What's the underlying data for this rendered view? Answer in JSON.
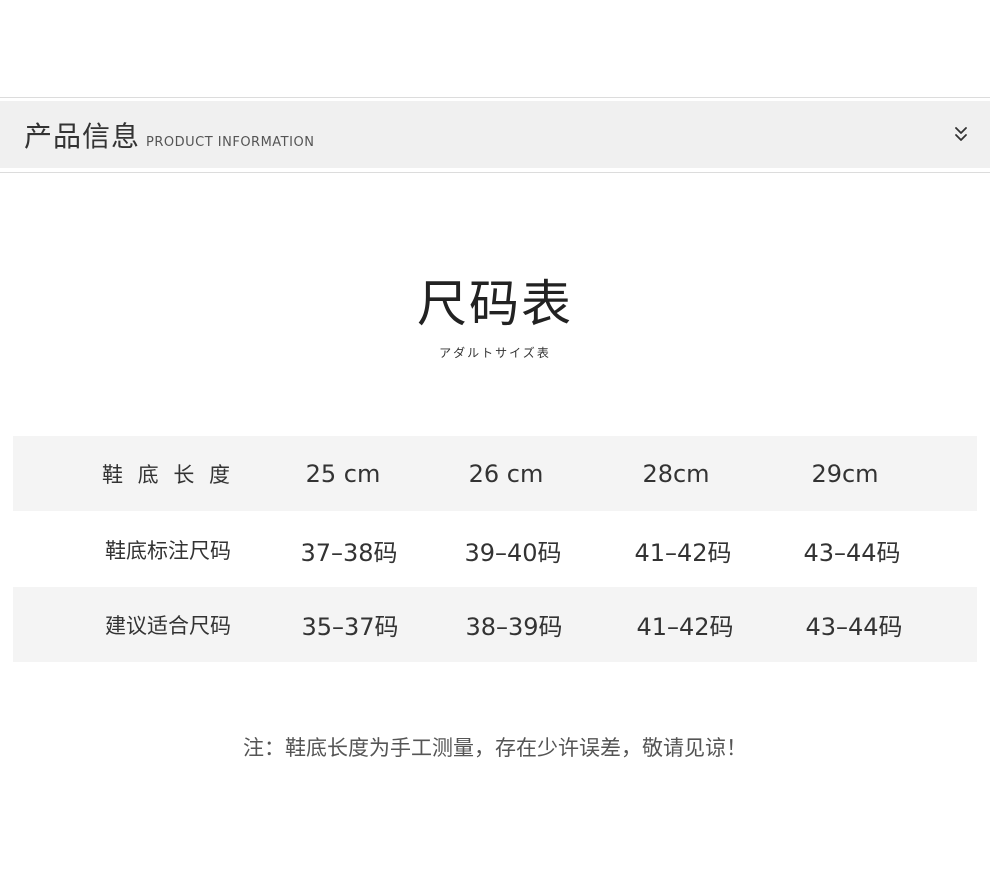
{
  "section": {
    "title_cn": "产品信息",
    "title_en": "PRODUCT INFORMATION",
    "toggle_icon": "double-chevron-down-icon"
  },
  "size_chart": {
    "title": "尺码表",
    "subtitle": "アダルトサイズ表",
    "rows": [
      {
        "label": "鞋 底 长 度",
        "values": [
          "25 cm",
          "26 cm",
          "28cm",
          "29cm"
        ]
      },
      {
        "label": "鞋底标注尺码",
        "values": [
          "37–38码",
          "39–40码",
          "41–42码",
          "43–44码"
        ]
      },
      {
        "label": "建议适合尺码",
        "values": [
          "35–37码",
          "38–39码",
          "41–42码",
          "43–44码"
        ]
      }
    ]
  },
  "note": "注：鞋底长度为手工测量，存在少许误差，敬请见谅！",
  "colors": {
    "header_bg": "#f0f0f0",
    "row_shade": "#f4f4f4",
    "text": "#333333"
  }
}
